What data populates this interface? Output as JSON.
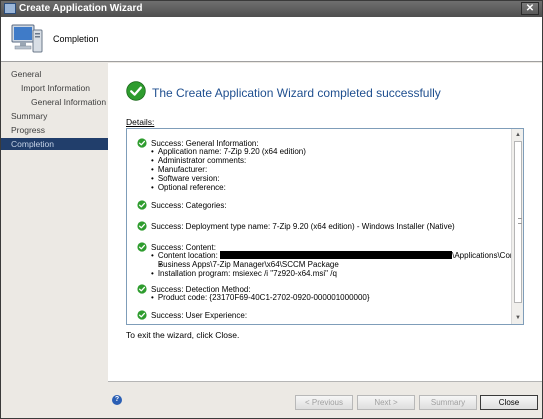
{
  "window": {
    "title": "Create Application Wizard",
    "close_glyph": "✕"
  },
  "header": {
    "title": "Completion",
    "icon": "computer-icon"
  },
  "sidebar": {
    "items": [
      {
        "label": "General"
      },
      {
        "label": "Import Information"
      },
      {
        "label": "General Information"
      },
      {
        "label": "Summary"
      },
      {
        "label": "Progress"
      },
      {
        "label": "Completion",
        "active": true
      }
    ]
  },
  "main": {
    "headline": "The Create Application Wizard completed successfully",
    "details_label": "Details:",
    "exit_text": "To exit the wizard, click Close.",
    "sections": [
      {
        "heading": "Success: General Information:",
        "items": [
          "Application name: 7-Zip 9.20 (x64 edition)",
          "Administrator comments:",
          "Manufacturer:",
          "Software version:",
          "Optional reference:"
        ]
      },
      {
        "heading": "Success: Categories:"
      },
      {
        "heading": "Success: Deployment type name: 7-Zip 9.20 (x64 edition) - Windows Installer (Native)"
      },
      {
        "heading": "Success: Content:",
        "content_location_label": "Content location:",
        "content_location_tail": "\\Applications\\Core",
        "content_location_cont": "Business Apps\\7-Zip Manager\\x64\\SCCM Package",
        "installation_program": "Installation program: msiexec /i \"7z920-x64.msi\" /q"
      },
      {
        "heading": "Success: Detection Method:",
        "items": [
          "Product code: {23170F69-40C1-2702-0920-000001000000}"
        ]
      },
      {
        "heading": "Success: User Experience:"
      }
    ]
  },
  "footer": {
    "help_glyph": "?",
    "buttons": {
      "previous": "< Previous",
      "next": "Next >",
      "summary": "Summary",
      "close": "Close"
    }
  },
  "colors": {
    "success_green": "#2e9c2e",
    "active_nav_bg": "#213e6b",
    "headline_blue": "#1f4f8f"
  }
}
